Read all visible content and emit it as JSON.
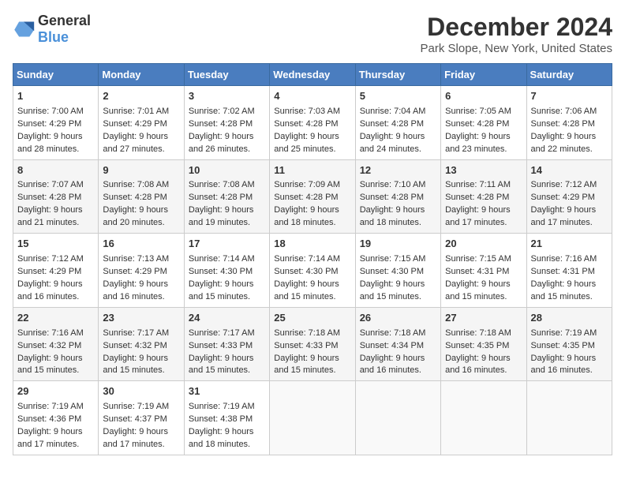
{
  "header": {
    "logo_general": "General",
    "logo_blue": "Blue",
    "title": "December 2024",
    "subtitle": "Park Slope, New York, United States"
  },
  "calendar": {
    "days_of_week": [
      "Sunday",
      "Monday",
      "Tuesday",
      "Wednesday",
      "Thursday",
      "Friday",
      "Saturday"
    ],
    "weeks": [
      [
        {
          "day": "1",
          "sunrise": "7:00 AM",
          "sunset": "4:29 PM",
          "daylight": "9 hours and 28 minutes."
        },
        {
          "day": "2",
          "sunrise": "7:01 AM",
          "sunset": "4:29 PM",
          "daylight": "9 hours and 27 minutes."
        },
        {
          "day": "3",
          "sunrise": "7:02 AM",
          "sunset": "4:28 PM",
          "daylight": "9 hours and 26 minutes."
        },
        {
          "day": "4",
          "sunrise": "7:03 AM",
          "sunset": "4:28 PM",
          "daylight": "9 hours and 25 minutes."
        },
        {
          "day": "5",
          "sunrise": "7:04 AM",
          "sunset": "4:28 PM",
          "daylight": "9 hours and 24 minutes."
        },
        {
          "day": "6",
          "sunrise": "7:05 AM",
          "sunset": "4:28 PM",
          "daylight": "9 hours and 23 minutes."
        },
        {
          "day": "7",
          "sunrise": "7:06 AM",
          "sunset": "4:28 PM",
          "daylight": "9 hours and 22 minutes."
        }
      ],
      [
        {
          "day": "8",
          "sunrise": "7:07 AM",
          "sunset": "4:28 PM",
          "daylight": "9 hours and 21 minutes."
        },
        {
          "day": "9",
          "sunrise": "7:08 AM",
          "sunset": "4:28 PM",
          "daylight": "9 hours and 20 minutes."
        },
        {
          "day": "10",
          "sunrise": "7:08 AM",
          "sunset": "4:28 PM",
          "daylight": "9 hours and 19 minutes."
        },
        {
          "day": "11",
          "sunrise": "7:09 AM",
          "sunset": "4:28 PM",
          "daylight": "9 hours and 18 minutes."
        },
        {
          "day": "12",
          "sunrise": "7:10 AM",
          "sunset": "4:28 PM",
          "daylight": "9 hours and 18 minutes."
        },
        {
          "day": "13",
          "sunrise": "7:11 AM",
          "sunset": "4:28 PM",
          "daylight": "9 hours and 17 minutes."
        },
        {
          "day": "14",
          "sunrise": "7:12 AM",
          "sunset": "4:29 PM",
          "daylight": "9 hours and 17 minutes."
        }
      ],
      [
        {
          "day": "15",
          "sunrise": "7:12 AM",
          "sunset": "4:29 PM",
          "daylight": "9 hours and 16 minutes."
        },
        {
          "day": "16",
          "sunrise": "7:13 AM",
          "sunset": "4:29 PM",
          "daylight": "9 hours and 16 minutes."
        },
        {
          "day": "17",
          "sunrise": "7:14 AM",
          "sunset": "4:30 PM",
          "daylight": "9 hours and 15 minutes."
        },
        {
          "day": "18",
          "sunrise": "7:14 AM",
          "sunset": "4:30 PM",
          "daylight": "9 hours and 15 minutes."
        },
        {
          "day": "19",
          "sunrise": "7:15 AM",
          "sunset": "4:30 PM",
          "daylight": "9 hours and 15 minutes."
        },
        {
          "day": "20",
          "sunrise": "7:15 AM",
          "sunset": "4:31 PM",
          "daylight": "9 hours and 15 minutes."
        },
        {
          "day": "21",
          "sunrise": "7:16 AM",
          "sunset": "4:31 PM",
          "daylight": "9 hours and 15 minutes."
        }
      ],
      [
        {
          "day": "22",
          "sunrise": "7:16 AM",
          "sunset": "4:32 PM",
          "daylight": "9 hours and 15 minutes."
        },
        {
          "day": "23",
          "sunrise": "7:17 AM",
          "sunset": "4:32 PM",
          "daylight": "9 hours and 15 minutes."
        },
        {
          "day": "24",
          "sunrise": "7:17 AM",
          "sunset": "4:33 PM",
          "daylight": "9 hours and 15 minutes."
        },
        {
          "day": "25",
          "sunrise": "7:18 AM",
          "sunset": "4:33 PM",
          "daylight": "9 hours and 15 minutes."
        },
        {
          "day": "26",
          "sunrise": "7:18 AM",
          "sunset": "4:34 PM",
          "daylight": "9 hours and 16 minutes."
        },
        {
          "day": "27",
          "sunrise": "7:18 AM",
          "sunset": "4:35 PM",
          "daylight": "9 hours and 16 minutes."
        },
        {
          "day": "28",
          "sunrise": "7:19 AM",
          "sunset": "4:35 PM",
          "daylight": "9 hours and 16 minutes."
        }
      ],
      [
        {
          "day": "29",
          "sunrise": "7:19 AM",
          "sunset": "4:36 PM",
          "daylight": "9 hours and 17 minutes."
        },
        {
          "day": "30",
          "sunrise": "7:19 AM",
          "sunset": "4:37 PM",
          "daylight": "9 hours and 17 minutes."
        },
        {
          "day": "31",
          "sunrise": "7:19 AM",
          "sunset": "4:38 PM",
          "daylight": "9 hours and 18 minutes."
        },
        null,
        null,
        null,
        null
      ]
    ]
  }
}
